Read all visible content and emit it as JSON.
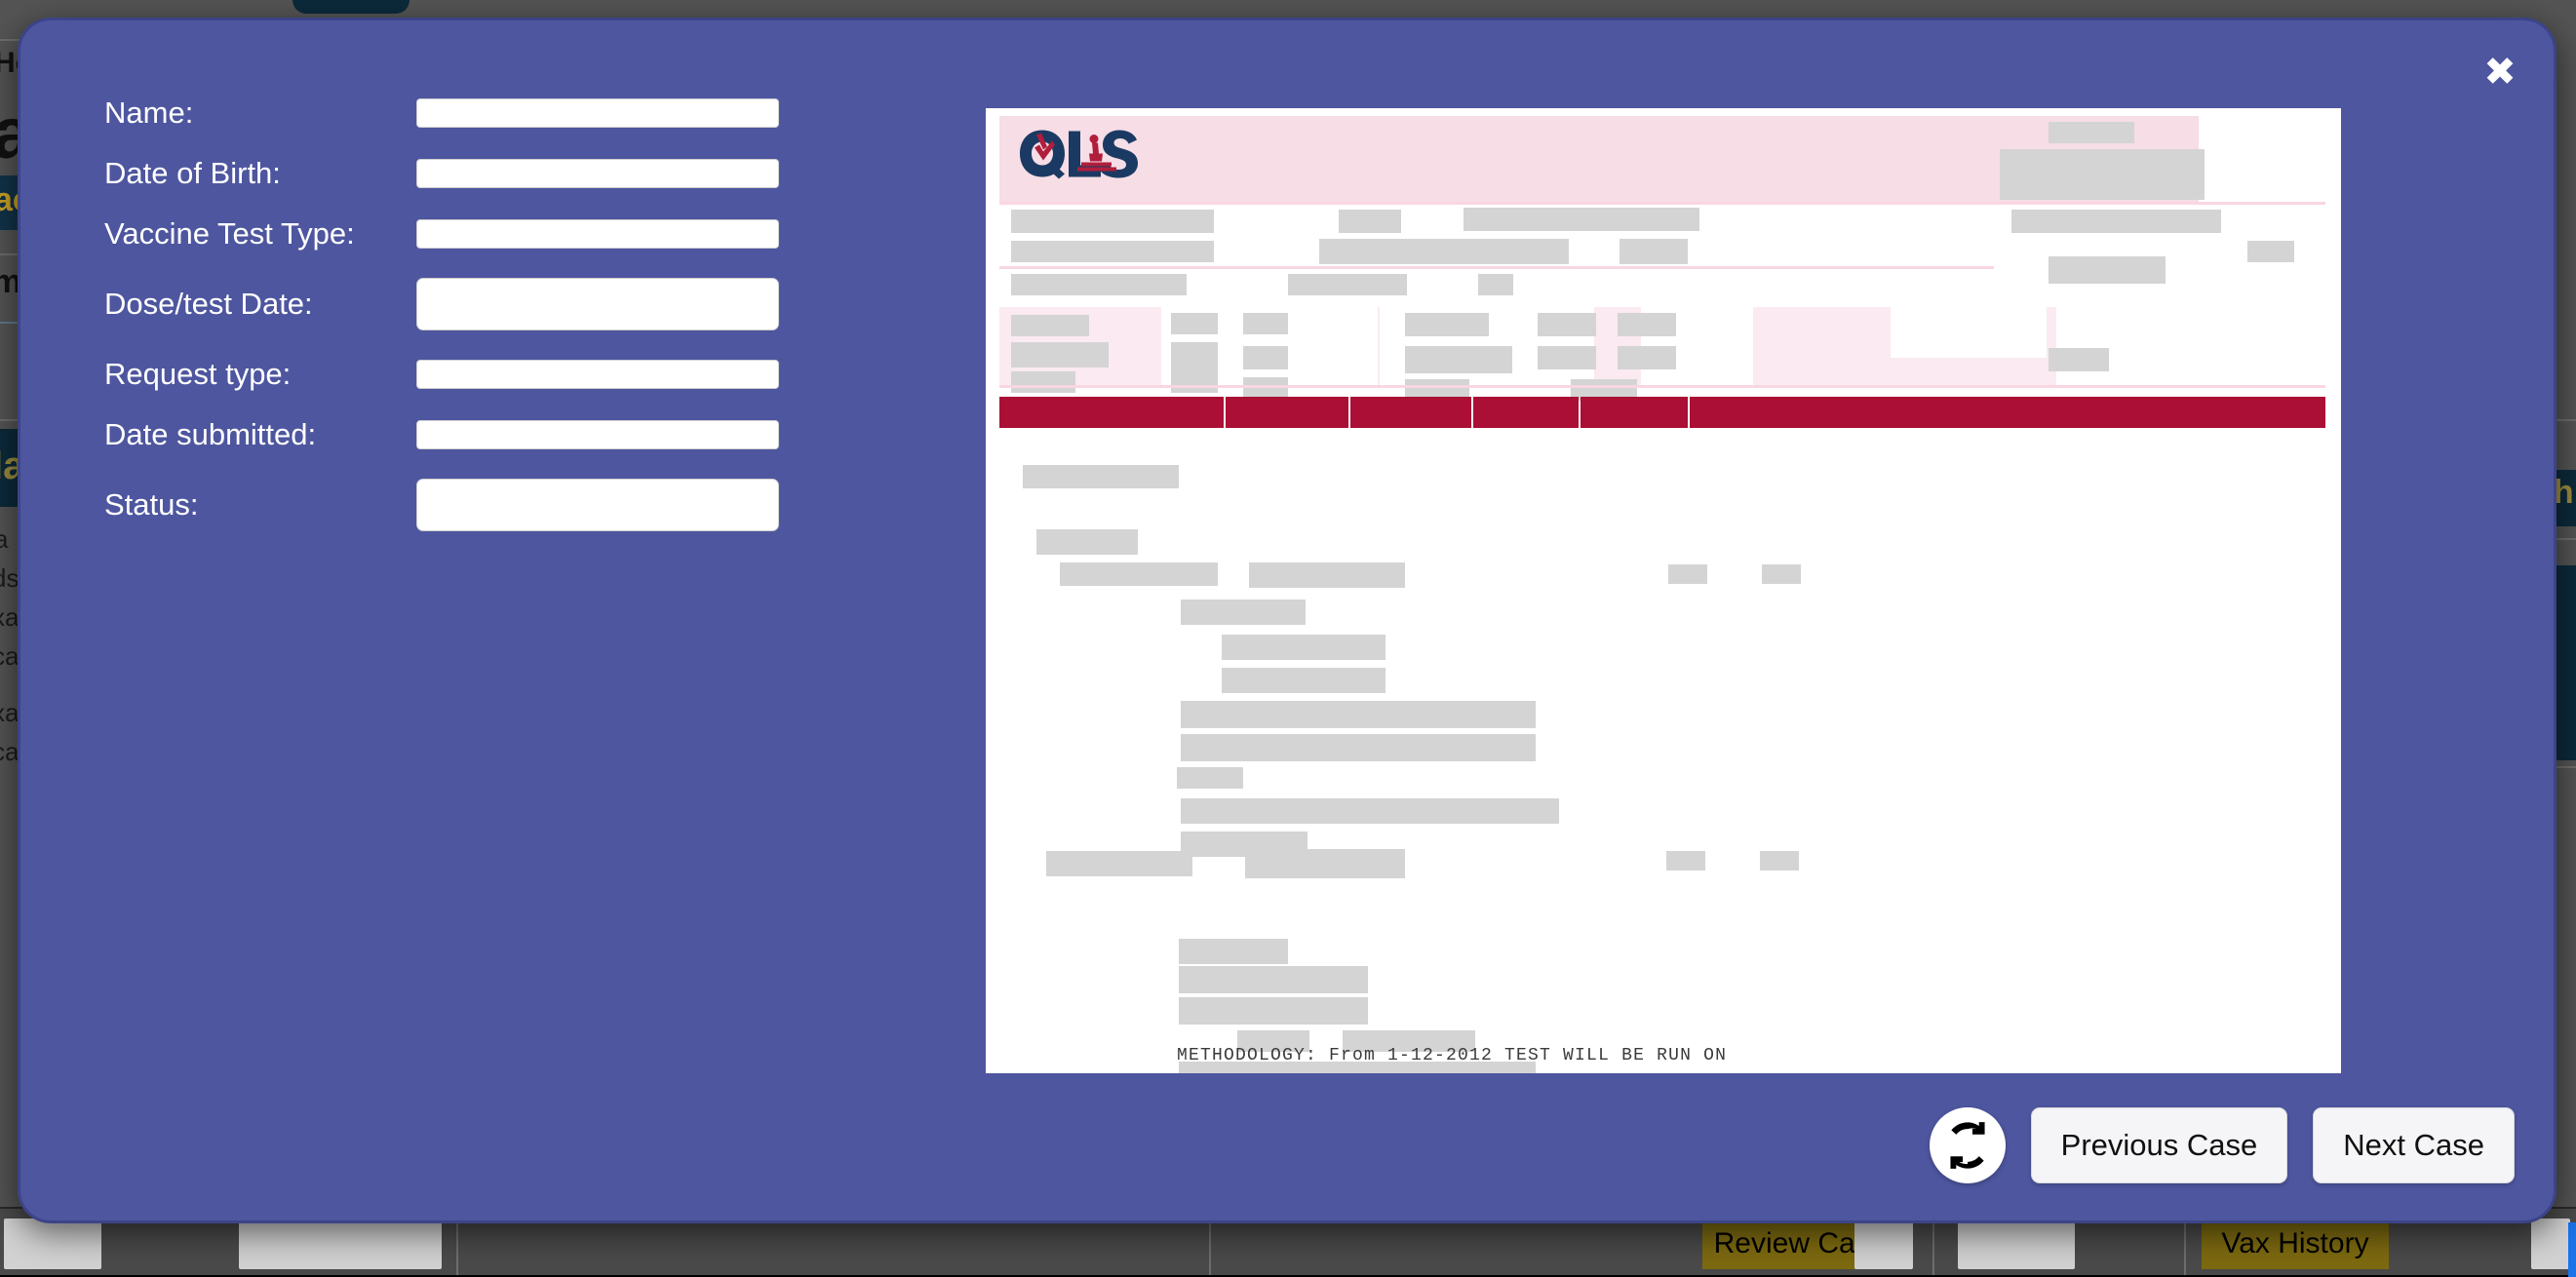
{
  "modal": {
    "close_icon": "close-icon",
    "background_color": "#4e569f",
    "form": {
      "fields": [
        {
          "label": "Name:",
          "value": "",
          "placeholder": ""
        },
        {
          "label": "Date of Birth:",
          "value": "",
          "placeholder": ""
        },
        {
          "label": "Vaccine Test Type:",
          "value": "",
          "placeholder": ""
        },
        {
          "label": "Dose/test Date:",
          "value": "",
          "placeholder": ""
        },
        {
          "label": "Request type:",
          "value": "",
          "placeholder": ""
        },
        {
          "label": "Date submitted:",
          "value": "",
          "placeholder": ""
        },
        {
          "label": "Status:",
          "value": "",
          "placeholder": ""
        }
      ]
    },
    "document_preview": {
      "logo_text": "QLS",
      "logo_icon": "microscope-icon",
      "header_color": "#f6dde6",
      "table_header_color": "#ab0f35",
      "methodology_line": "METHODOLOGY: From 1-12-2012 TEST WILL BE RUN ON"
    },
    "footer": {
      "refresh_icon": "refresh-icon",
      "previous_label": "Previous Case",
      "next_label": "Next Case"
    }
  },
  "background": {
    "taskbar": {
      "review_case_label": "Review Case",
      "vax_history_label": "Vax History"
    },
    "fragments": {
      "ho": "Ho",
      "a": "a",
      "ac": "ac",
      "mi": "mi",
      "la": "la",
      "a2": "a",
      "ds": "ds",
      "xa": "xa",
      "ca": "ca",
      "xa2": "xa",
      "ca2": "ca",
      "sh": "sh"
    }
  }
}
